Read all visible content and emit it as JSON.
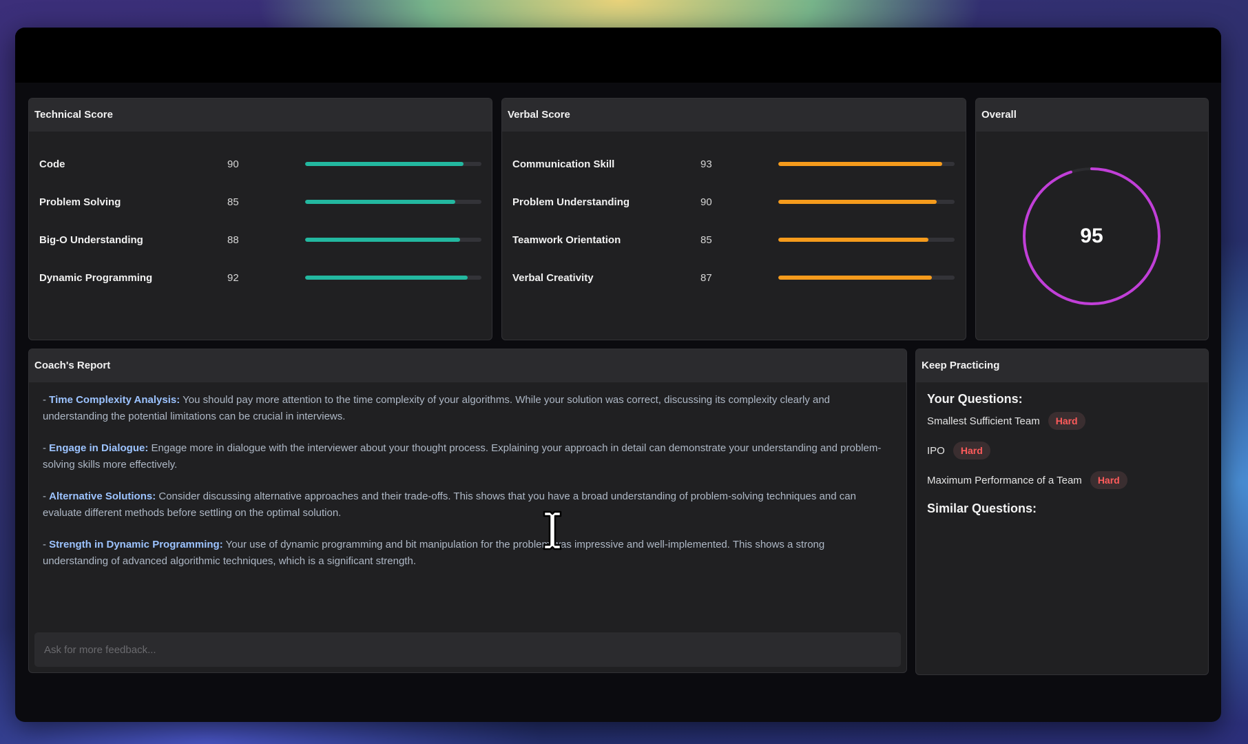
{
  "technical": {
    "title": "Technical Score",
    "items": [
      {
        "label": "Code",
        "value": "90",
        "pct": 90
      },
      {
        "label": "Problem Solving",
        "value": "85",
        "pct": 85
      },
      {
        "label": "Big-O Understanding",
        "value": "88",
        "pct": 88
      },
      {
        "label": "Dynamic Programming",
        "value": "92",
        "pct": 92
      }
    ],
    "color": "#23b8a0"
  },
  "verbal": {
    "title": "Verbal Score",
    "items": [
      {
        "label": "Communication Skill",
        "value": "93",
        "pct": 93
      },
      {
        "label": "Problem Understanding",
        "value": "90",
        "pct": 90
      },
      {
        "label": "Teamwork Orientation",
        "value": "85",
        "pct": 85
      },
      {
        "label": "Verbal Creativity",
        "value": "87",
        "pct": 87
      }
    ],
    "color": "#f59b1c"
  },
  "overall": {
    "title": "Overall",
    "score": "95",
    "pct": 95,
    "color": "#c13fd8"
  },
  "report": {
    "title": "Coach's Report",
    "items": [
      {
        "keyword": "Time Complexity Analysis:",
        "text": "You should pay more attention to the time complexity of your algorithms. While your solution was correct, discussing its complexity clearly and understanding the potential limitations can be crucial in interviews."
      },
      {
        "keyword": "Engage in Dialogue:",
        "text": "Engage more in dialogue with the interviewer about your thought process. Explaining your approach in detail can demonstrate your understanding and problem-solving skills more effectively."
      },
      {
        "keyword": "Alternative Solutions:",
        "text": "Consider discussing alternative approaches and their trade-offs. This shows that you have a broad understanding of problem-solving techniques and can evaluate different methods before settling on the optimal solution."
      },
      {
        "keyword": "Strength in Dynamic Programming:",
        "text": "Your use of dynamic programming and bit manipulation for the problem was impressive and well-implemented. This shows a strong understanding of advanced algorithmic techniques, which is a significant strength."
      }
    ],
    "feedback_placeholder": "Ask for more feedback..."
  },
  "practice": {
    "title": "Keep Practicing",
    "your_questions_label": "Your Questions:",
    "questions": [
      {
        "name": "Smallest Sufficient Team",
        "difficulty": "Hard"
      },
      {
        "name": "IPO",
        "difficulty": "Hard"
      },
      {
        "name": "Maximum Performance of a Team",
        "difficulty": "Hard"
      }
    ],
    "similar_label": "Similar Questions:"
  }
}
